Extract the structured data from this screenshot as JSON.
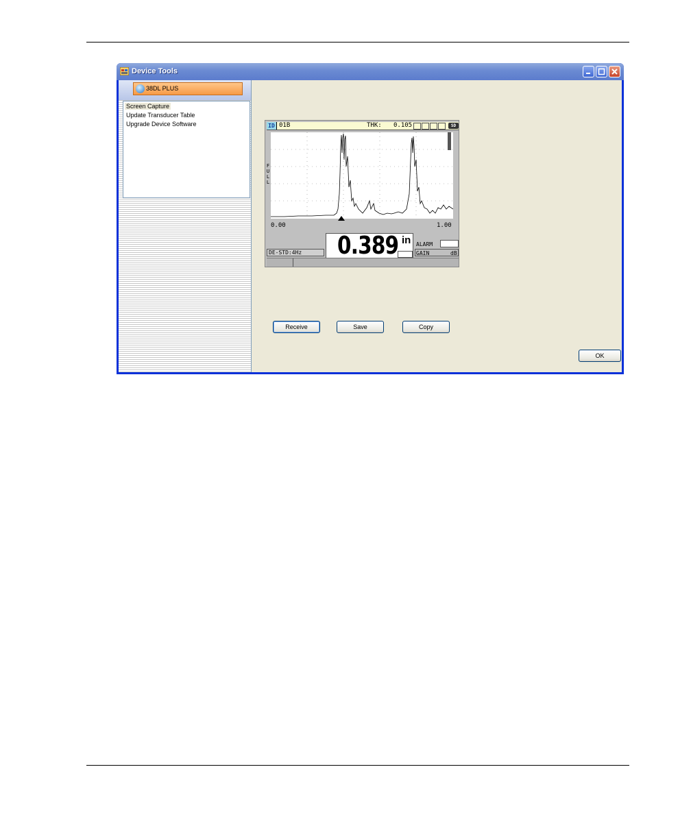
{
  "window": {
    "title": "Device Tools"
  },
  "sidebar": {
    "device_label": "38DL PLUS",
    "items": [
      {
        "label": "Screen Capture",
        "selected": true
      },
      {
        "label": "Update Transducer Table",
        "selected": false
      },
      {
        "label": "Upgrade Device Software",
        "selected": false
      }
    ]
  },
  "screen": {
    "id_badge": "ID",
    "id_value": "01B",
    "thk_label": "THK:",
    "thk_value": "0.105",
    "sd_badge": "SD",
    "full_label": "FULL",
    "x_min": "0.00",
    "x_max": "1.00",
    "mode": "DE-STD:4Hz",
    "reading": "0.389",
    "unit": "in",
    "alarm_label": "ALARM",
    "gain_label": "GAIN",
    "gain_unit": "dB"
  },
  "buttons": {
    "receive": "Receive",
    "save": "Save",
    "copy": "Copy",
    "ok": "OK"
  }
}
